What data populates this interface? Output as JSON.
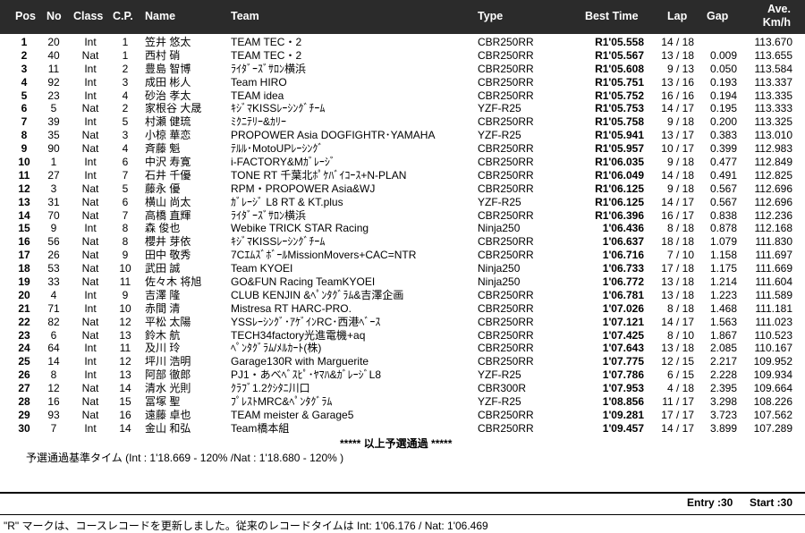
{
  "headers": {
    "pos": "Pos",
    "no": "No",
    "class": "Class",
    "cp": "C.P.",
    "name": "Name",
    "team": "Team",
    "type": "Type",
    "best": "Best Time",
    "lap": "Lap",
    "gap": "Gap",
    "avg_line1": "Ave.",
    "avg_line2": "Km/h"
  },
  "rows": [
    {
      "pos": "1",
      "no": "20",
      "class": "Int",
      "cp": "1",
      "name": "笠井 悠太",
      "team": "TEAM TEC・2",
      "type": "CBR250RR",
      "best": "R1'05.558",
      "lap": "14 / 18",
      "gap": "",
      "avg": "113.670"
    },
    {
      "pos": "2",
      "no": "40",
      "class": "Nat",
      "cp": "1",
      "name": "西村 硝",
      "team": "TEAM TEC・2",
      "type": "CBR250RR",
      "best": "R1'05.567",
      "lap": "13 / 18",
      "gap": "0.009",
      "avg": "113.655"
    },
    {
      "pos": "3",
      "no": "11",
      "class": "Int",
      "cp": "2",
      "name": "豊島 智博",
      "team": "ﾗｲﾀﾞｰｽﾞｻﾛﾝ横浜",
      "type": "CBR250RR",
      "best": "R1'05.608",
      "lap": "9 / 13",
      "gap": "0.050",
      "avg": "113.584"
    },
    {
      "pos": "4",
      "no": "92",
      "class": "Int",
      "cp": "3",
      "name": "成田 彬人",
      "team": "Team HIRO",
      "type": "CBR250RR",
      "best": "R1'05.751",
      "lap": "13 / 16",
      "gap": "0.193",
      "avg": "113.337"
    },
    {
      "pos": "5",
      "no": "23",
      "class": "Int",
      "cp": "4",
      "name": "砂治 孝太",
      "team": "TEAM idea",
      "type": "CBR250RR",
      "best": "R1'05.752",
      "lap": "16 / 16",
      "gap": "0.194",
      "avg": "113.335"
    },
    {
      "pos": "6",
      "no": "5",
      "class": "Nat",
      "cp": "2",
      "name": "家根谷 大晟",
      "team": "ｷｼﾞﾏKISSﾚｰｼﾝｸﾞﾁｰﾑ",
      "type": "YZF-R25",
      "best": "R1'05.753",
      "lap": "14 / 17",
      "gap": "0.195",
      "avg": "113.333"
    },
    {
      "pos": "7",
      "no": "39",
      "class": "Int",
      "cp": "5",
      "name": "村瀬 健琉",
      "team": "ﾐｸﾆﾃﾘｰ&ｶﾘｰ",
      "type": "CBR250RR",
      "best": "R1'05.758",
      "lap": "9 / 18",
      "gap": "0.200",
      "avg": "113.325"
    },
    {
      "pos": "8",
      "no": "35",
      "class": "Nat",
      "cp": "3",
      "name": "小椋 華恋",
      "team": "PROPOWER Asia DOGFIGHTR･YAMAHA",
      "type": "YZF-R25",
      "best": "R1'05.941",
      "lap": "13 / 17",
      "gap": "0.383",
      "avg": "113.010"
    },
    {
      "pos": "9",
      "no": "90",
      "class": "Nat",
      "cp": "4",
      "name": "斉藤 魁",
      "team": "ﾃﾙﾙ･MotoUPﾚｰｼﾝｸﾞ",
      "type": "CBR250RR",
      "best": "R1'05.957",
      "lap": "10 / 17",
      "gap": "0.399",
      "avg": "112.983"
    },
    {
      "pos": "10",
      "no": "1",
      "class": "Int",
      "cp": "6",
      "name": "中沢 寿寛",
      "team": "i-FACTORY&Mｶﾞﾚｰｼﾞ",
      "type": "CBR250RR",
      "best": "R1'06.035",
      "lap": "9 / 18",
      "gap": "0.477",
      "avg": "112.849"
    },
    {
      "pos": "11",
      "no": "27",
      "class": "Int",
      "cp": "7",
      "name": "石井 千優",
      "team": "TONE RT 千葉北ﾎﾟｹﾊﾞｲｺｰｽ+N-PLAN",
      "type": "CBR250RR",
      "best": "R1'06.049",
      "lap": "14 / 18",
      "gap": "0.491",
      "avg": "112.825"
    },
    {
      "pos": "12",
      "no": "3",
      "class": "Nat",
      "cp": "5",
      "name": "藤永 優",
      "team": "RPM・PROPOWER Asia&WJ",
      "type": "CBR250RR",
      "best": "R1'06.125",
      "lap": "9 / 18",
      "gap": "0.567",
      "avg": "112.696"
    },
    {
      "pos": "13",
      "no": "31",
      "class": "Nat",
      "cp": "6",
      "name": "横山 尚太",
      "team": "ｶﾞﾚｰｼﾞ L8 RT & KT.plus",
      "type": "YZF-R25",
      "best": "R1'06.125",
      "lap": "14 / 17",
      "gap": "0.567",
      "avg": "112.696"
    },
    {
      "pos": "14",
      "no": "70",
      "class": "Nat",
      "cp": "7",
      "name": "高橋 直輝",
      "team": "ﾗｲﾀﾞｰｽﾞｻﾛﾝ横浜",
      "type": "CBR250RR",
      "best": "R1'06.396",
      "lap": "16 / 17",
      "gap": "0.838",
      "avg": "112.236"
    },
    {
      "pos": "15",
      "no": "9",
      "class": "Int",
      "cp": "8",
      "name": "森 俊也",
      "team": "Webike TRICK STAR Racing",
      "type": "Ninja250",
      "best": "1'06.436",
      "lap": "8 / 18",
      "gap": "0.878",
      "avg": "112.168"
    },
    {
      "pos": "16",
      "no": "56",
      "class": "Nat",
      "cp": "8",
      "name": "櫻井 芽依",
      "team": "ｷｼﾞﾏKISSﾚｰｼﾝｸﾞﾁｰﾑ",
      "type": "CBR250RR",
      "best": "1'06.637",
      "lap": "18 / 18",
      "gap": "1.079",
      "avg": "111.830"
    },
    {
      "pos": "17",
      "no": "26",
      "class": "Nat",
      "cp": "9",
      "name": "田中 敬秀",
      "team": "7CｴﾑｽﾞﾎﾞｰﾙMissionMovers+CAC=NTR",
      "type": "CBR250RR",
      "best": "1'06.716",
      "lap": "7 / 10",
      "gap": "1.158",
      "avg": "111.697"
    },
    {
      "pos": "18",
      "no": "53",
      "class": "Nat",
      "cp": "10",
      "name": "武田 誠",
      "team": "Team KYOEI",
      "type": "Ninja250",
      "best": "1'06.733",
      "lap": "17 / 18",
      "gap": "1.175",
      "avg": "111.669"
    },
    {
      "pos": "19",
      "no": "33",
      "class": "Nat",
      "cp": "11",
      "name": "佐々木 将旭",
      "team": "GO&FUN Racing TeamKYOEI",
      "type": "Ninja250",
      "best": "1'06.772",
      "lap": "13 / 18",
      "gap": "1.214",
      "avg": "111.604"
    },
    {
      "pos": "20",
      "no": "4",
      "class": "Int",
      "cp": "9",
      "name": "吉澤 隆",
      "team": "CLUB KENJIN &ﾍﾟﾝﾀｸﾞﾗﾑ&吉澤企画",
      "type": "CBR250RR",
      "best": "1'06.781",
      "lap": "13 / 18",
      "gap": "1.223",
      "avg": "111.589"
    },
    {
      "pos": "21",
      "no": "71",
      "class": "Int",
      "cp": "10",
      "name": "赤間 清",
      "team": "Mistresa RT HARC-PRO.",
      "type": "CBR250RR",
      "best": "1'07.026",
      "lap": "8 / 18",
      "gap": "1.468",
      "avg": "111.181"
    },
    {
      "pos": "22",
      "no": "82",
      "class": "Nat",
      "cp": "12",
      "name": "平松 太陽",
      "team": "YSSﾚｰｼﾝｸﾞ･ｱｹﾞｲﾝRC･西港ﾍﾞｰｽ",
      "type": "CBR250RR",
      "best": "1'07.121",
      "lap": "14 / 17",
      "gap": "1.563",
      "avg": "111.023"
    },
    {
      "pos": "23",
      "no": "6",
      "class": "Nat",
      "cp": "13",
      "name": "鈴木 航",
      "team": "TECH34factory光進電機+aq",
      "type": "CBR250RR",
      "best": "1'07.425",
      "lap": "8 / 10",
      "gap": "1.867",
      "avg": "110.523"
    },
    {
      "pos": "24",
      "no": "64",
      "class": "Int",
      "cp": "11",
      "name": "及川 玲",
      "team": "ﾍﾟﾝﾀｸﾞﾗﾑ/ﾒﾙｶｰﾄ(株)",
      "type": "CBR250RR",
      "best": "1'07.643",
      "lap": "13 / 18",
      "gap": "2.085",
      "avg": "110.167"
    },
    {
      "pos": "25",
      "no": "14",
      "class": "Int",
      "cp": "12",
      "name": "坪川 浩明",
      "team": "Garage130R with Marguerite",
      "type": "CBR250RR",
      "best": "1'07.775",
      "lap": "12 / 15",
      "gap": "2.217",
      "avg": "109.952"
    },
    {
      "pos": "26",
      "no": "8",
      "class": "Int",
      "cp": "13",
      "name": "阿部 徹郎",
      "team": "PJ1・あべﾍﾞｽﾋﾟ･ﾔﾏﾊ&ｶﾞﾚｰｼﾞL8",
      "type": "YZF-R25",
      "best": "1'07.786",
      "lap": "6 / 15",
      "gap": "2.228",
      "avg": "109.934"
    },
    {
      "pos": "27",
      "no": "12",
      "class": "Nat",
      "cp": "14",
      "name": "清水 光則",
      "team": "ｸﾗﾌﾞ1.2ｸｼﾀﾆ川口",
      "type": "CBR300R",
      "best": "1'07.953",
      "lap": "4 / 18",
      "gap": "2.395",
      "avg": "109.664"
    },
    {
      "pos": "28",
      "no": "16",
      "class": "Nat",
      "cp": "15",
      "name": "冨塚 聖",
      "team": "ﾌﾟﾚｽﾄMRC&ﾍﾟﾝﾀｸﾞﾗﾑ",
      "type": "YZF-R25",
      "best": "1'08.856",
      "lap": "11 / 17",
      "gap": "3.298",
      "avg": "108.226"
    },
    {
      "pos": "29",
      "no": "93",
      "class": "Nat",
      "cp": "16",
      "name": "遠藤 卓也",
      "team": "TEAM meister & Garage5",
      "type": "CBR250RR",
      "best": "1'09.281",
      "lap": "17 / 17",
      "gap": "3.723",
      "avg": "107.562"
    },
    {
      "pos": "30",
      "no": "7",
      "class": "Int",
      "cp": "14",
      "name": "金山 和弘",
      "team": "Team橋本組",
      "type": "CBR250RR",
      "best": "1'09.457",
      "lap": "14 / 17",
      "gap": "3.899",
      "avg": "107.289"
    }
  ],
  "qualify_note": "***** 以上予選通過 *****",
  "qualify_standard": "予選通過基準タイム (Int : 1'18.669 - 120% /Nat : 1'18.680 - 120% )",
  "entry": "Entry :30",
  "start": "Start :30",
  "record_note": "\"R\" マークは、コースレコードを更新しました。従来のレコードタイムは Int: 1'06.176 / Nat: 1'06.469"
}
